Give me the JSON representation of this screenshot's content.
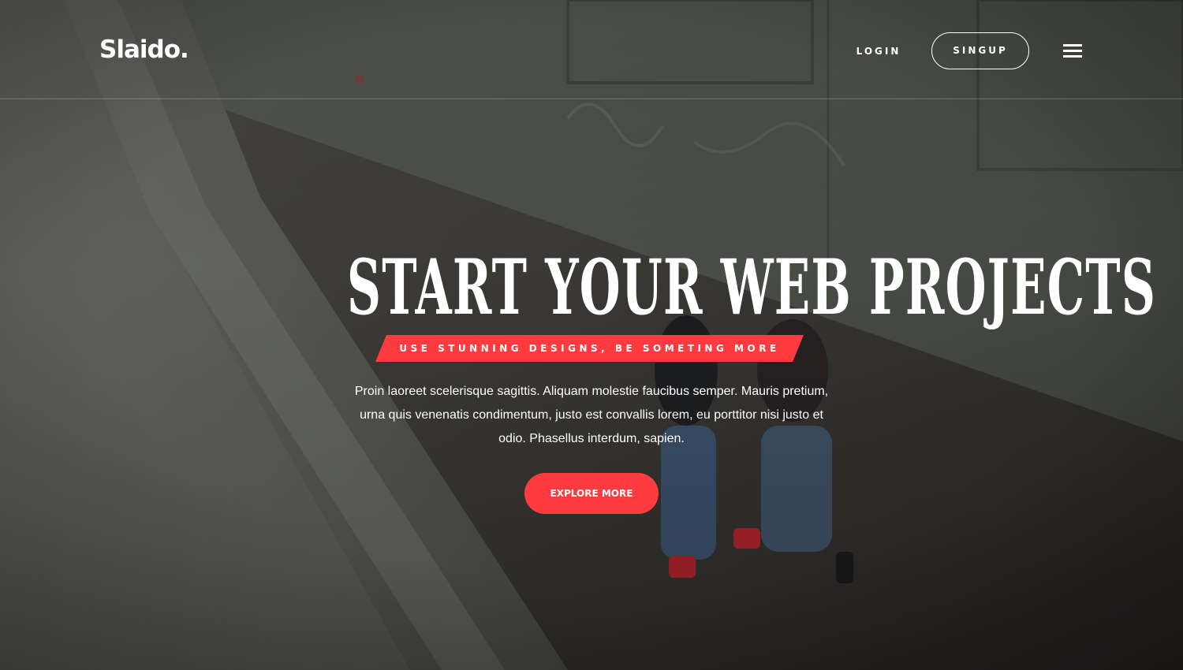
{
  "colors": {
    "accent": "#ff3b3f",
    "text": "#ffffff"
  },
  "header": {
    "logo": "Slaido.",
    "login_label": "LOGIN",
    "signup_label": "SINGUP",
    "menu_icon": "hamburger-menu-icon"
  },
  "hero": {
    "headline": "START YOUR WEB PROJECTS",
    "tagline": "USE STUNNING DESIGNS, BE SOMETING MORE",
    "description": "Proin laoreet scelerisque sagittis. Aliquam molestie faucibus semper. Mauris pretium, urna quis venenatis condimentum, justo est convallis lorem, eu porttitor nisi justo et odio. Phasellus interdum, sapien.",
    "cta_label": "EXPLORE MORE"
  }
}
